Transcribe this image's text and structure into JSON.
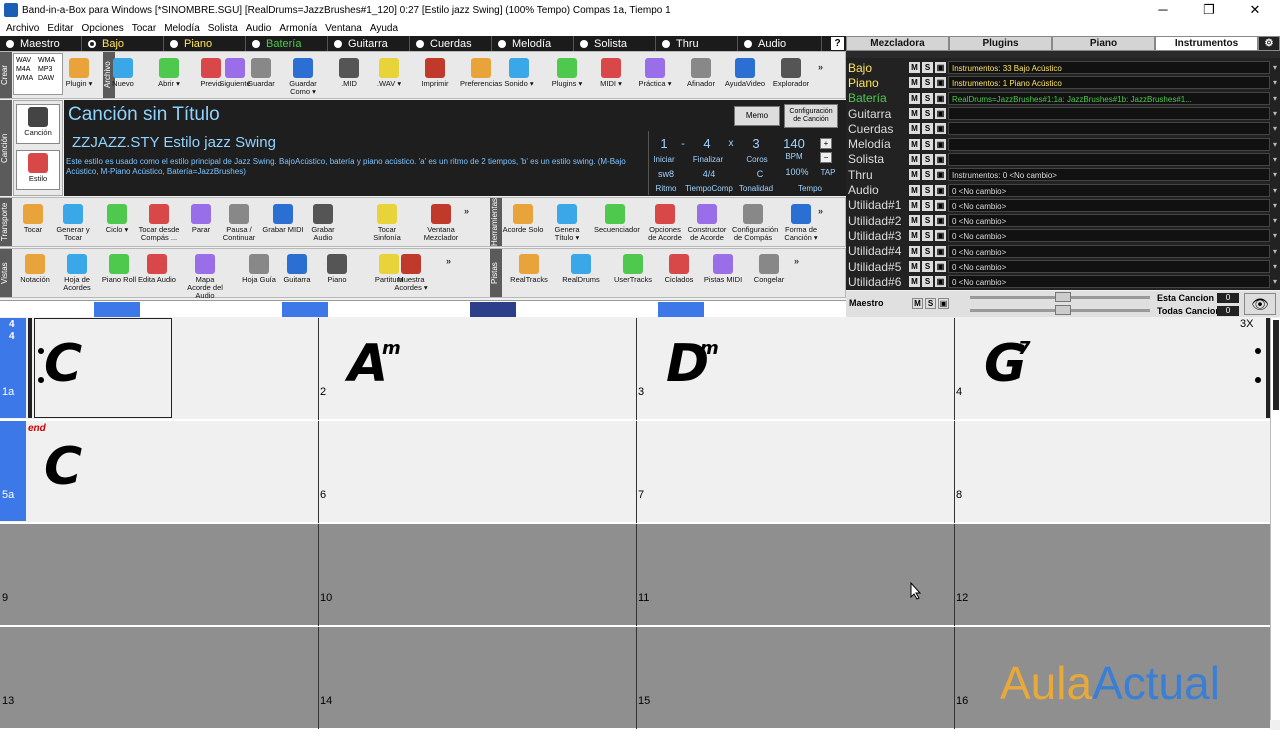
{
  "window": {
    "title": "Band-in-a-Box para Windows  [*SINOMBRE.SGU] [RealDrums=JazzBrushes#1_120]  0:27  [Estilo jazz Swing] (100% Tempo)  Compas 1a, Tiempo 1",
    "minimize": "─",
    "maximize": "❐",
    "close": "✕"
  },
  "menu": [
    "Archivo",
    "Editar",
    "Opciones",
    "Tocar",
    "Melodía",
    "Solista",
    "Audio",
    "Armonía",
    "Ventana",
    "Ayuda"
  ],
  "tracks_bar": [
    {
      "label": "Maestro",
      "selected": false,
      "color": "white"
    },
    {
      "label": "Bajo",
      "selected": true,
      "color": "yellow"
    },
    {
      "label": "Piano",
      "selected": false,
      "color": "yellow"
    },
    {
      "label": "Batería",
      "selected": false,
      "color": "green"
    },
    {
      "label": "Guitarra",
      "selected": false,
      "color": "white"
    },
    {
      "label": "Cuerdas",
      "selected": false,
      "color": "white"
    },
    {
      "label": "Melodía",
      "selected": false,
      "color": "white"
    },
    {
      "label": "Solista",
      "selected": false,
      "color": "white"
    },
    {
      "label": "Thru",
      "selected": false,
      "color": "white"
    },
    {
      "label": "Audio",
      "selected": false,
      "color": "white"
    }
  ],
  "help": "?",
  "right_tabs": [
    "Mezcladora",
    "Plugins",
    "Piano",
    "Instrumentos"
  ],
  "right_tabs_selected": "Instrumentos",
  "side_labels": {
    "crear": "Crear",
    "archivo": "Archivo",
    "cancion": "Canción",
    "transporte": "Transporte",
    "vistas": "Vistas",
    "herramientas": "Herramientas",
    "pistas": "Pistas"
  },
  "create_box": [
    "WAV",
    "WMA",
    "M4A",
    "MP3",
    "WMA",
    "DAW"
  ],
  "file_tools": [
    {
      "label": "Plugin ▾",
      "icon": "plugin-icon"
    },
    {
      "label": "Nuevo",
      "icon": "new-icon"
    },
    {
      "label": "Abrir ▾",
      "icon": "open-icon"
    },
    {
      "label": "Previo",
      "icon": "previous-icon"
    },
    {
      "label": "Siguiente",
      "icon": "next-icon"
    },
    {
      "label": "Guardar",
      "icon": "save-icon"
    },
    {
      "label": "Guardar Como ▾",
      "icon": "save-as-icon"
    },
    {
      "label": ".MID",
      "icon": "midi-file-icon"
    },
    {
      "label": ".WAV ▾",
      "icon": "wav-file-icon"
    },
    {
      "label": "Imprimir",
      "icon": "print-icon"
    },
    {
      "label": "Preferencias",
      "icon": "preferences-icon"
    },
    {
      "label": "Sonido ▾",
      "icon": "sound-icon"
    },
    {
      "label": "Plugins ▾",
      "icon": "plugins-icon"
    },
    {
      "label": "MIDI ▾",
      "icon": "midi-icon"
    },
    {
      "label": "Práctica ▾",
      "icon": "practice-icon"
    },
    {
      "label": "Afinador",
      "icon": "tuner-icon"
    },
    {
      "label": "AyudaVideo",
      "icon": "video-help-icon"
    },
    {
      "label": "Explorador",
      "icon": "explorer-icon"
    }
  ],
  "song_buttons": [
    {
      "label": "Canción",
      "icon": "song-icon"
    },
    {
      "label": "Estilo",
      "icon": "style-icon"
    }
  ],
  "song": {
    "title": "Canción sin Título",
    "style": "ZZJAZZ.STY Estilo jazz Swing",
    "description": "Este estilo es usado como el estilo principal de Jazz Swing. BajoAcústico, batería y piano acústico. 'a' es un ritmo de 2 tiempos, 'b' es un estilo swing. (M-Bajo Acústico, M-Piano Acústico, Batería=JazzBrushes)",
    "memo": "Memo",
    "config": "Configuración de Canción",
    "inicio": "1",
    "inicio_label": "Iniciar",
    "dash": "-",
    "finalizar": "4",
    "finalizar_label": "Finalizar",
    "x": "x",
    "coros": "3",
    "coros_label": "Coros",
    "ritmo": "sw8",
    "ritmo_label": "Ritmo",
    "tiempo": "4/4",
    "tiempo_label": "TiempoComp",
    "tonalidad": "C",
    "tonalidad_label": "Tonalidad",
    "bpm": "140",
    "bpm_unit": "BPM",
    "tempo_pct": "100%",
    "tempo_label": "Tempo",
    "tap": "TAP",
    "plus": "+",
    "minus": "−"
  },
  "transport_tools": [
    {
      "label": "Tocar",
      "icon": "play-icon"
    },
    {
      "label": "Generar y Tocar",
      "icon": "generate-play-icon"
    },
    {
      "label": "Ciclo ▾",
      "icon": "loop-icon"
    },
    {
      "label": "Tocar desde Compás ...",
      "icon": "play-from-icon"
    },
    {
      "label": "Parar",
      "icon": "stop-icon"
    },
    {
      "label": "Pausa / Continuar",
      "icon": "pause-icon"
    },
    {
      "label": "Grabar MIDI",
      "icon": "record-midi-icon"
    },
    {
      "label": "Grabar Audio",
      "icon": "record-audio-icon"
    },
    {
      "label": "Tocar Sinfonía",
      "icon": "play-symphony-icon"
    },
    {
      "label": "Ventana Mezclador",
      "icon": "mixer-window-icon"
    }
  ],
  "tools_tools": [
    {
      "label": "Acorde Solo",
      "icon": "chord-solo-icon"
    },
    {
      "label": "Genera Título ▾",
      "icon": "generate-title-icon"
    },
    {
      "label": "Secuenciador",
      "icon": "sequencer-icon"
    },
    {
      "label": "Opciones de Acorde",
      "icon": "chord-options-icon"
    },
    {
      "label": "Constructor de Acorde",
      "icon": "chord-builder-icon"
    },
    {
      "label": "Configuración de Compás",
      "icon": "bar-settings-icon"
    },
    {
      "label": "Forma de Canción ▾",
      "icon": "song-form-icon"
    }
  ],
  "view_tools": [
    {
      "label": "Notación",
      "icon": "notation-icon"
    },
    {
      "label": "Hoja de Acordes",
      "icon": "chord-sheet-icon"
    },
    {
      "label": "Piano Roll",
      "icon": "piano-roll-icon"
    },
    {
      "label": "Edita Audio",
      "icon": "edit-audio-icon"
    },
    {
      "label": "Mapa Acorde del Audio",
      "icon": "audio-chord-map-icon"
    },
    {
      "label": "Hoja Guía",
      "icon": "lead-sheet-icon"
    },
    {
      "label": "Guitarra",
      "icon": "guitar-icon"
    },
    {
      "label": "Piano",
      "icon": "piano-icon"
    },
    {
      "label": "Partitura",
      "icon": "score-icon"
    },
    {
      "label": "Muestra Acordes ▾",
      "icon": "show-chords-icon"
    }
  ],
  "track_tools": [
    {
      "label": "RealTracks",
      "icon": "realtracks-icon"
    },
    {
      "label": "RealDrums",
      "icon": "realdrums-icon"
    },
    {
      "label": "UserTracks",
      "icon": "usertracks-icon"
    },
    {
      "label": "Ciclados",
      "icon": "loops-icon"
    },
    {
      "label": "Pistas MIDI",
      "icon": "midi-tracks-icon"
    },
    {
      "label": "Congelar",
      "icon": "freeze-icon"
    }
  ],
  "mixer": [
    {
      "name": "Bajo",
      "inst": "Instrumentos: 33 Bajo Acústico",
      "nc": "y",
      "ic": "y"
    },
    {
      "name": "Piano",
      "inst": "Instrumentos: 1 Piano Acústico",
      "nc": "y",
      "ic": "y"
    },
    {
      "name": "Batería",
      "inst": "RealDrums=JazzBrushes#1:1a: JazzBrushes#1b: JazzBrushes#1...",
      "nc": "g",
      "ic": "g"
    },
    {
      "name": "Guitarra",
      "inst": "",
      "nc": "w",
      "ic": "w"
    },
    {
      "name": "Cuerdas",
      "inst": "",
      "nc": "w",
      "ic": "w"
    },
    {
      "name": "Melodía",
      "inst": "",
      "nc": "w",
      "ic": "w"
    },
    {
      "name": "Solista",
      "inst": "",
      "nc": "w",
      "ic": "w"
    },
    {
      "name": "Thru",
      "inst": "Instrumentos: 0 <No cambio>",
      "nc": "w",
      "ic": "w"
    },
    {
      "name": "Audio",
      "inst": "0 <No cambio>",
      "nc": "w",
      "ic": "w"
    },
    {
      "name": "Utilidad#1",
      "inst": "0 <No cambio>",
      "nc": "w",
      "ic": "w"
    },
    {
      "name": "Utilidad#2",
      "inst": "0 <No cambio>",
      "nc": "w",
      "ic": "w"
    },
    {
      "name": "Utilidad#3",
      "inst": "0 <No cambio>",
      "nc": "w",
      "ic": "w"
    },
    {
      "name": "Utilidad#4",
      "inst": "0 <No cambio>",
      "nc": "w",
      "ic": "w"
    },
    {
      "name": "Utilidad#5",
      "inst": "0 <No cambio>",
      "nc": "w",
      "ic": "w"
    },
    {
      "name": "Utilidad#6",
      "inst": "0 <No cambio>",
      "nc": "w",
      "ic": "w"
    }
  ],
  "mixer_buttons": {
    "m": "M",
    "s": "S",
    "a": "▣"
  },
  "maestro": {
    "label": "Maestro",
    "esta": "Esta Cancion",
    "todas": "Todas Cancion",
    "v1": "0",
    "v2": "0"
  },
  "sheet": {
    "time_sig_top": "4",
    "time_sig_bottom": "4",
    "repeat_count": "3X",
    "end_label": "end",
    "bars": [
      {
        "num": "1a",
        "chord": "C",
        "sup": ""
      },
      {
        "num": "2",
        "chord": "A",
        "sup": "m"
      },
      {
        "num": "3",
        "chord": "D",
        "sup": "m"
      },
      {
        "num": "4",
        "chord": "G",
        "sup": "7"
      },
      {
        "num": "5a",
        "chord": "C",
        "sup": ""
      },
      {
        "num": "6",
        "chord": "",
        "sup": ""
      },
      {
        "num": "7",
        "chord": "",
        "sup": ""
      },
      {
        "num": "8",
        "chord": "",
        "sup": ""
      },
      {
        "num": "9",
        "chord": "",
        "sup": ""
      },
      {
        "num": "10",
        "chord": "",
        "sup": ""
      },
      {
        "num": "11",
        "chord": "",
        "sup": ""
      },
      {
        "num": "12",
        "chord": "",
        "sup": ""
      },
      {
        "num": "13",
        "chord": "",
        "sup": ""
      },
      {
        "num": "14",
        "chord": "",
        "sup": ""
      },
      {
        "num": "15",
        "chord": "",
        "sup": ""
      },
      {
        "num": "16",
        "chord": "",
        "sup": ""
      }
    ]
  },
  "watermark": {
    "a": "Aula",
    "b": "Actual"
  },
  "colors": {
    "accent_blue": "#3c78e8",
    "dark_panel": "#1e1e1e",
    "song_text": "#8fd3ff",
    "yellow": "#ffe45c",
    "green": "#4ec94e"
  }
}
